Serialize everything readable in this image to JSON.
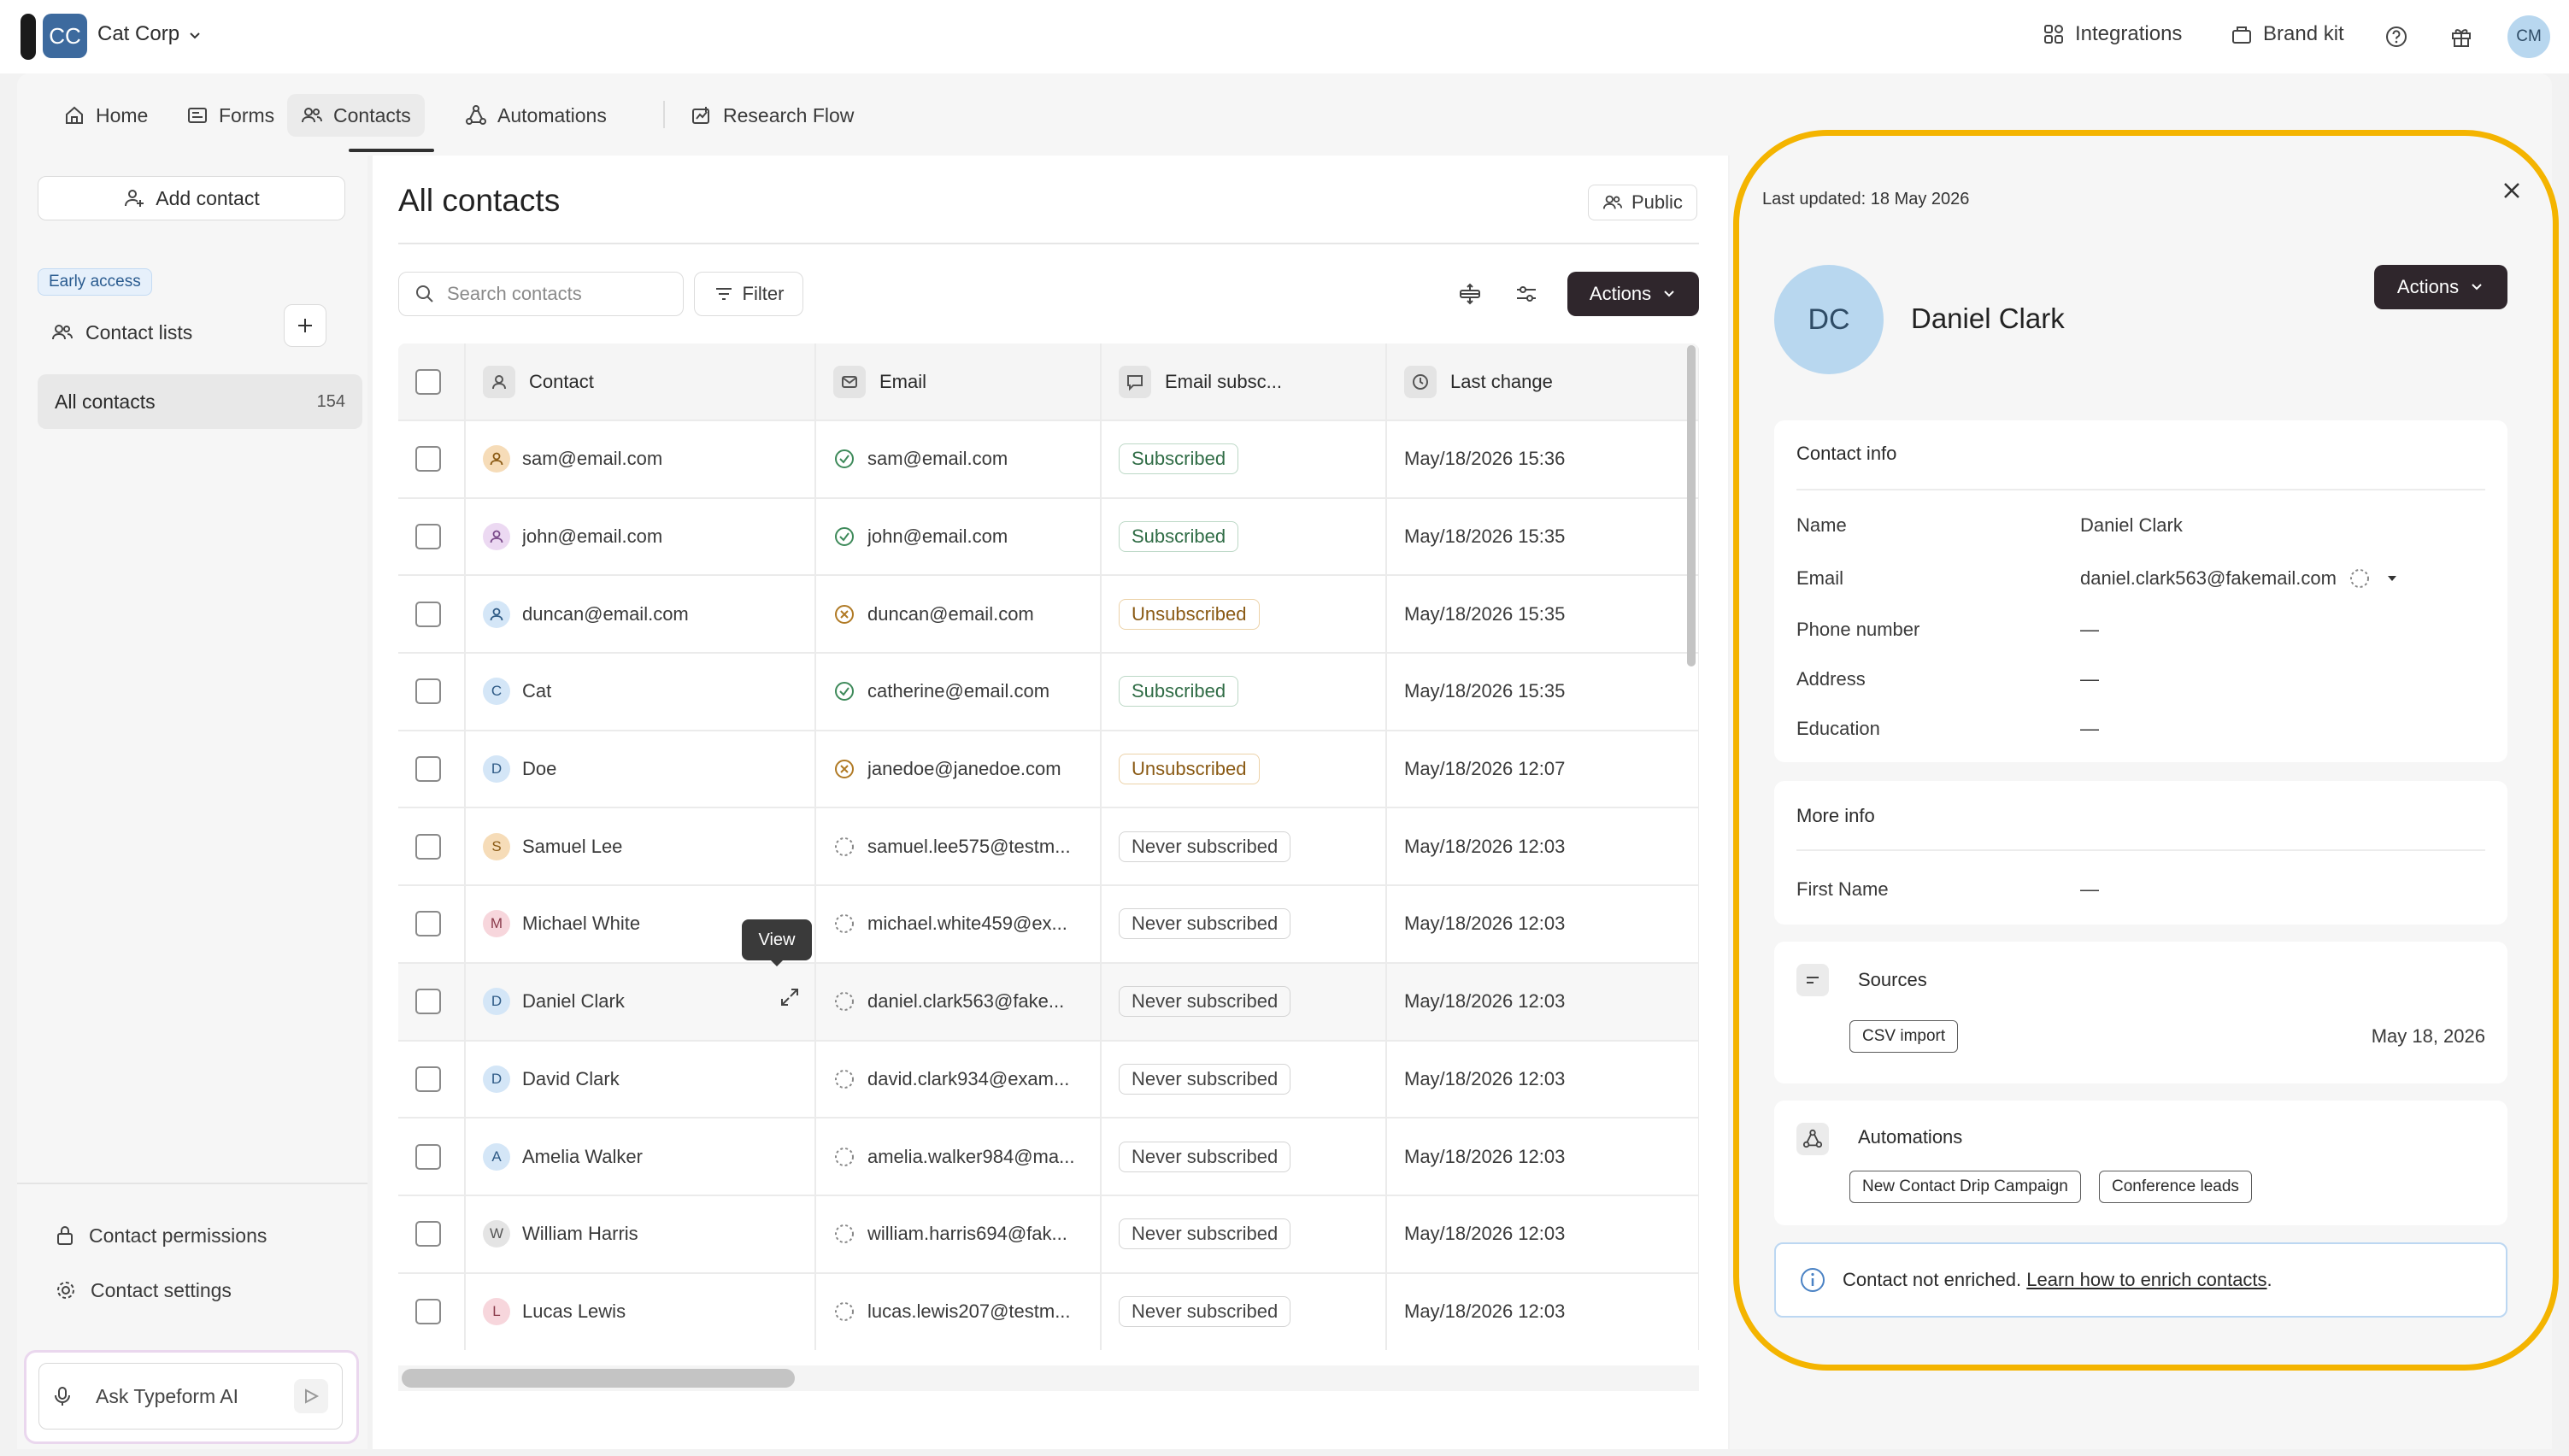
{
  "workspace": {
    "initials": "CC",
    "name": "Cat Corp"
  },
  "topbar": {
    "integrations": "Integrations",
    "brand_kit": "Brand kit",
    "user_initials": "CM"
  },
  "nav": {
    "tabs": [
      {
        "label": "Home",
        "icon": "home-icon"
      },
      {
        "label": "Forms",
        "icon": "forms-icon"
      },
      {
        "label": "Contacts",
        "icon": "contacts-icon",
        "active": true
      },
      {
        "label": "Automations",
        "icon": "automations-icon"
      },
      {
        "label": "Research Flow",
        "icon": "research-flow-icon"
      }
    ]
  },
  "sidebar": {
    "add_contact": "Add contact",
    "early_access": "Early access",
    "contact_lists": "Contact lists",
    "all_contacts": {
      "label": "All contacts",
      "count": "154"
    },
    "permissions": "Contact permissions",
    "settings": "Contact settings",
    "ask_ai": "Ask Typeform AI"
  },
  "main": {
    "title": "All contacts",
    "public_label": "Public",
    "search_placeholder": "Search contacts",
    "filter_label": "Filter",
    "actions_label": "Actions",
    "tooltip": "View",
    "columns": [
      "Contact",
      "Email",
      "Email subsc...",
      "Last change"
    ],
    "rows": [
      {
        "contact": "sam@email.com",
        "initial": "",
        "av_bg": "#f6dcb8",
        "av_fg": "#8a5a14",
        "email": "sam@email.com",
        "email_status": "verified",
        "subscription": "Subscribed",
        "sub_type": "sub",
        "last_change": "May/18/2026 15:36"
      },
      {
        "contact": "john@email.com",
        "initial": "",
        "av_bg": "#ecd9f2",
        "av_fg": "#7a4a8a",
        "email": "john@email.com",
        "email_status": "verified",
        "subscription": "Subscribed",
        "sub_type": "sub",
        "last_change": "May/18/2026 15:35"
      },
      {
        "contact": "duncan@email.com",
        "initial": "",
        "av_bg": "#d4e6f7",
        "av_fg": "#2f5b86",
        "email": "duncan@email.com",
        "email_status": "invalid",
        "subscription": "Unsubscribed",
        "sub_type": "unsub",
        "last_change": "May/18/2026 15:35"
      },
      {
        "contact": "Cat",
        "initial": "C",
        "av_bg": "#d4e6f7",
        "av_fg": "#2f5b86",
        "email": "catherine@email.com",
        "email_status": "verified",
        "subscription": "Subscribed",
        "sub_type": "sub",
        "last_change": "May/18/2026 15:35"
      },
      {
        "contact": "Doe",
        "initial": "D",
        "av_bg": "#d4e6f7",
        "av_fg": "#2f5b86",
        "email": "janedoe@janedoe.com",
        "email_status": "invalid",
        "subscription": "Unsubscribed",
        "sub_type": "unsub",
        "last_change": "May/18/2026 12:07"
      },
      {
        "contact": "Samuel Lee",
        "initial": "S",
        "av_bg": "#f6dcb8",
        "av_fg": "#8a5a14",
        "email": "samuel.lee575@testm...",
        "email_status": "unknown",
        "subscription": "Never subscribed",
        "sub_type": "never",
        "last_change": "May/18/2026 12:03"
      },
      {
        "contact": "Michael White",
        "initial": "M",
        "av_bg": "#f7d6dc",
        "av_fg": "#8a3a4a",
        "email": "michael.white459@ex...",
        "email_status": "unknown",
        "subscription": "Never subscribed",
        "sub_type": "never",
        "last_change": "May/18/2026 12:03"
      },
      {
        "contact": "Daniel Clark",
        "initial": "D",
        "av_bg": "#d4e6f7",
        "av_fg": "#2f5b86",
        "email": "daniel.clark563@fake...",
        "email_status": "unknown",
        "subscription": "Never subscribed",
        "sub_type": "never",
        "last_change": "May/18/2026 12:03",
        "hovered": true
      },
      {
        "contact": "David Clark",
        "initial": "D",
        "av_bg": "#d4e6f7",
        "av_fg": "#2f5b86",
        "email": "david.clark934@exam...",
        "email_status": "unknown",
        "subscription": "Never subscribed",
        "sub_type": "never",
        "last_change": "May/18/2026 12:03"
      },
      {
        "contact": "Amelia Walker",
        "initial": "A",
        "av_bg": "#d4e6f7",
        "av_fg": "#2f5b86",
        "email": "amelia.walker984@ma...",
        "email_status": "unknown",
        "subscription": "Never subscribed",
        "sub_type": "never",
        "last_change": "May/18/2026 12:03"
      },
      {
        "contact": "William Harris",
        "initial": "W",
        "av_bg": "#e4e4e4",
        "av_fg": "#555555",
        "email": "william.harris694@fak...",
        "email_status": "unknown",
        "subscription": "Never subscribed",
        "sub_type": "never",
        "last_change": "May/18/2026 12:03"
      },
      {
        "contact": "Lucas Lewis",
        "initial": "L",
        "av_bg": "#f7d6dc",
        "av_fg": "#8a3a4a",
        "email": "lucas.lewis207@testm...",
        "email_status": "unknown",
        "subscription": "Never subscribed",
        "sub_type": "never",
        "last_change": "May/18/2026 12:03"
      }
    ]
  },
  "detail": {
    "last_updated": "Last updated: 18 May 2026",
    "initials": "DC",
    "name": "Daniel Clark",
    "actions_label": "Actions",
    "contact_info": {
      "title": "Contact info",
      "fields": [
        {
          "key": "Name",
          "value": "Daniel Clark"
        },
        {
          "key": "Email",
          "value": "daniel.clark563@fakemail.com"
        },
        {
          "key": "Phone number",
          "value": "—"
        },
        {
          "key": "Address",
          "value": "—"
        },
        {
          "key": "Education",
          "value": "—"
        }
      ]
    },
    "more_info": {
      "title": "More info",
      "fields": [
        {
          "key": "First Name",
          "value": "—"
        }
      ]
    },
    "sources": {
      "title": "Sources",
      "tag": "CSV import",
      "date": "May 18, 2026"
    },
    "automations": {
      "title": "Automations",
      "tags": [
        "New Contact Drip Campaign",
        "Conference leads"
      ]
    },
    "enrich": {
      "text": "Contact not enriched.",
      "link": "Learn how to enrich contacts",
      "suffix": "."
    }
  },
  "colors": {
    "highlight": "#f4b400",
    "dark_button": "#2f262c",
    "subscribed": "#2f6c45",
    "unsubscribed": "#8a5a14"
  }
}
